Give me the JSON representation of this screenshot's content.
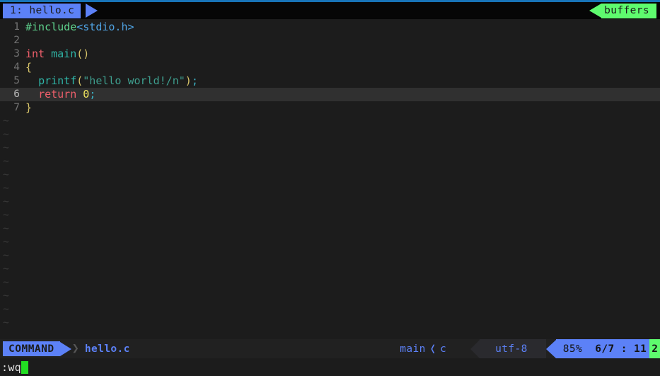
{
  "window": {
    "border_color": "#1874b8",
    "background": "#1c1c1c"
  },
  "tabline": {
    "tab_label": "1: hello.c",
    "tab_bg": "#5c81f7",
    "buffers_label": "buffers",
    "buffers_bg": "#5efb6e"
  },
  "editor": {
    "lines": [
      {
        "num": "1",
        "tokens": [
          {
            "text": "#include",
            "cls": "t-preproc"
          },
          {
            "text": "<stdio.h>",
            "cls": "t-include"
          }
        ]
      },
      {
        "num": "2",
        "tokens": []
      },
      {
        "num": "3",
        "tokens": [
          {
            "text": "int",
            "cls": "t-type"
          },
          {
            "text": " ",
            "cls": "t-plain"
          },
          {
            "text": "main",
            "cls": "t-func"
          },
          {
            "text": "()",
            "cls": "t-paren"
          }
        ]
      },
      {
        "num": "4",
        "tokens": [
          {
            "text": "{",
            "cls": "t-brace"
          }
        ]
      },
      {
        "num": "5",
        "tokens": [
          {
            "text": "  ",
            "cls": "t-plain"
          },
          {
            "text": "printf",
            "cls": "t-func"
          },
          {
            "text": "(",
            "cls": "t-paren"
          },
          {
            "text": "\"hello world!/n\"",
            "cls": "t-string"
          },
          {
            "text": ")",
            "cls": "t-paren"
          },
          {
            "text": ";",
            "cls": "t-punct"
          }
        ]
      },
      {
        "num": "6",
        "tokens": [
          {
            "text": "  ",
            "cls": "t-plain"
          },
          {
            "text": "return",
            "cls": "t-keyword"
          },
          {
            "text": " ",
            "cls": "t-plain"
          },
          {
            "text": "0",
            "cls": "t-number"
          },
          {
            "text": ";",
            "cls": "t-punct"
          }
        ]
      },
      {
        "num": "7",
        "tokens": [
          {
            "text": "}",
            "cls": "t-brace"
          }
        ]
      }
    ],
    "cursor_line_index": 5,
    "filler_symbol": "~",
    "filler_count": 16
  },
  "statusline": {
    "mode": "COMMAND",
    "separator": "❯",
    "filename": "hello.c",
    "branch": "main",
    "branch_separator": "❬",
    "filetype": "c",
    "encoding": "utf-8",
    "percent": "85%",
    "line_total": "6/7",
    "colon": ":",
    "column": "11",
    "column_badge": "2"
  },
  "cmdline": {
    "text": ":wq",
    "cursor_color": "#22dd22"
  }
}
